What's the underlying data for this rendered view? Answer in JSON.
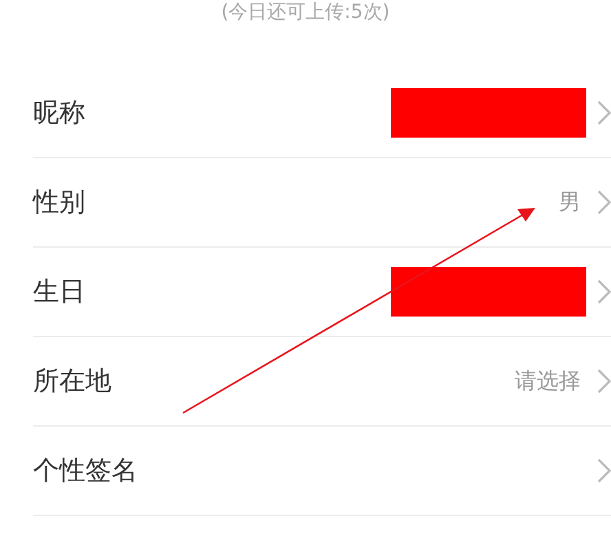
{
  "upload_hint": "(今日还可上传:5次)",
  "rows": [
    {
      "label": "昵称",
      "kind": "redacted"
    },
    {
      "label": "性别",
      "kind": "text",
      "value": "男"
    },
    {
      "label": "生日",
      "kind": "redacted"
    },
    {
      "label": "所在地",
      "kind": "text",
      "value": "请选择"
    },
    {
      "label": "个性签名",
      "kind": "empty"
    },
    {
      "kind": "blank"
    }
  ],
  "annotation": {
    "kind": "arrow",
    "color": "#e8141c"
  }
}
